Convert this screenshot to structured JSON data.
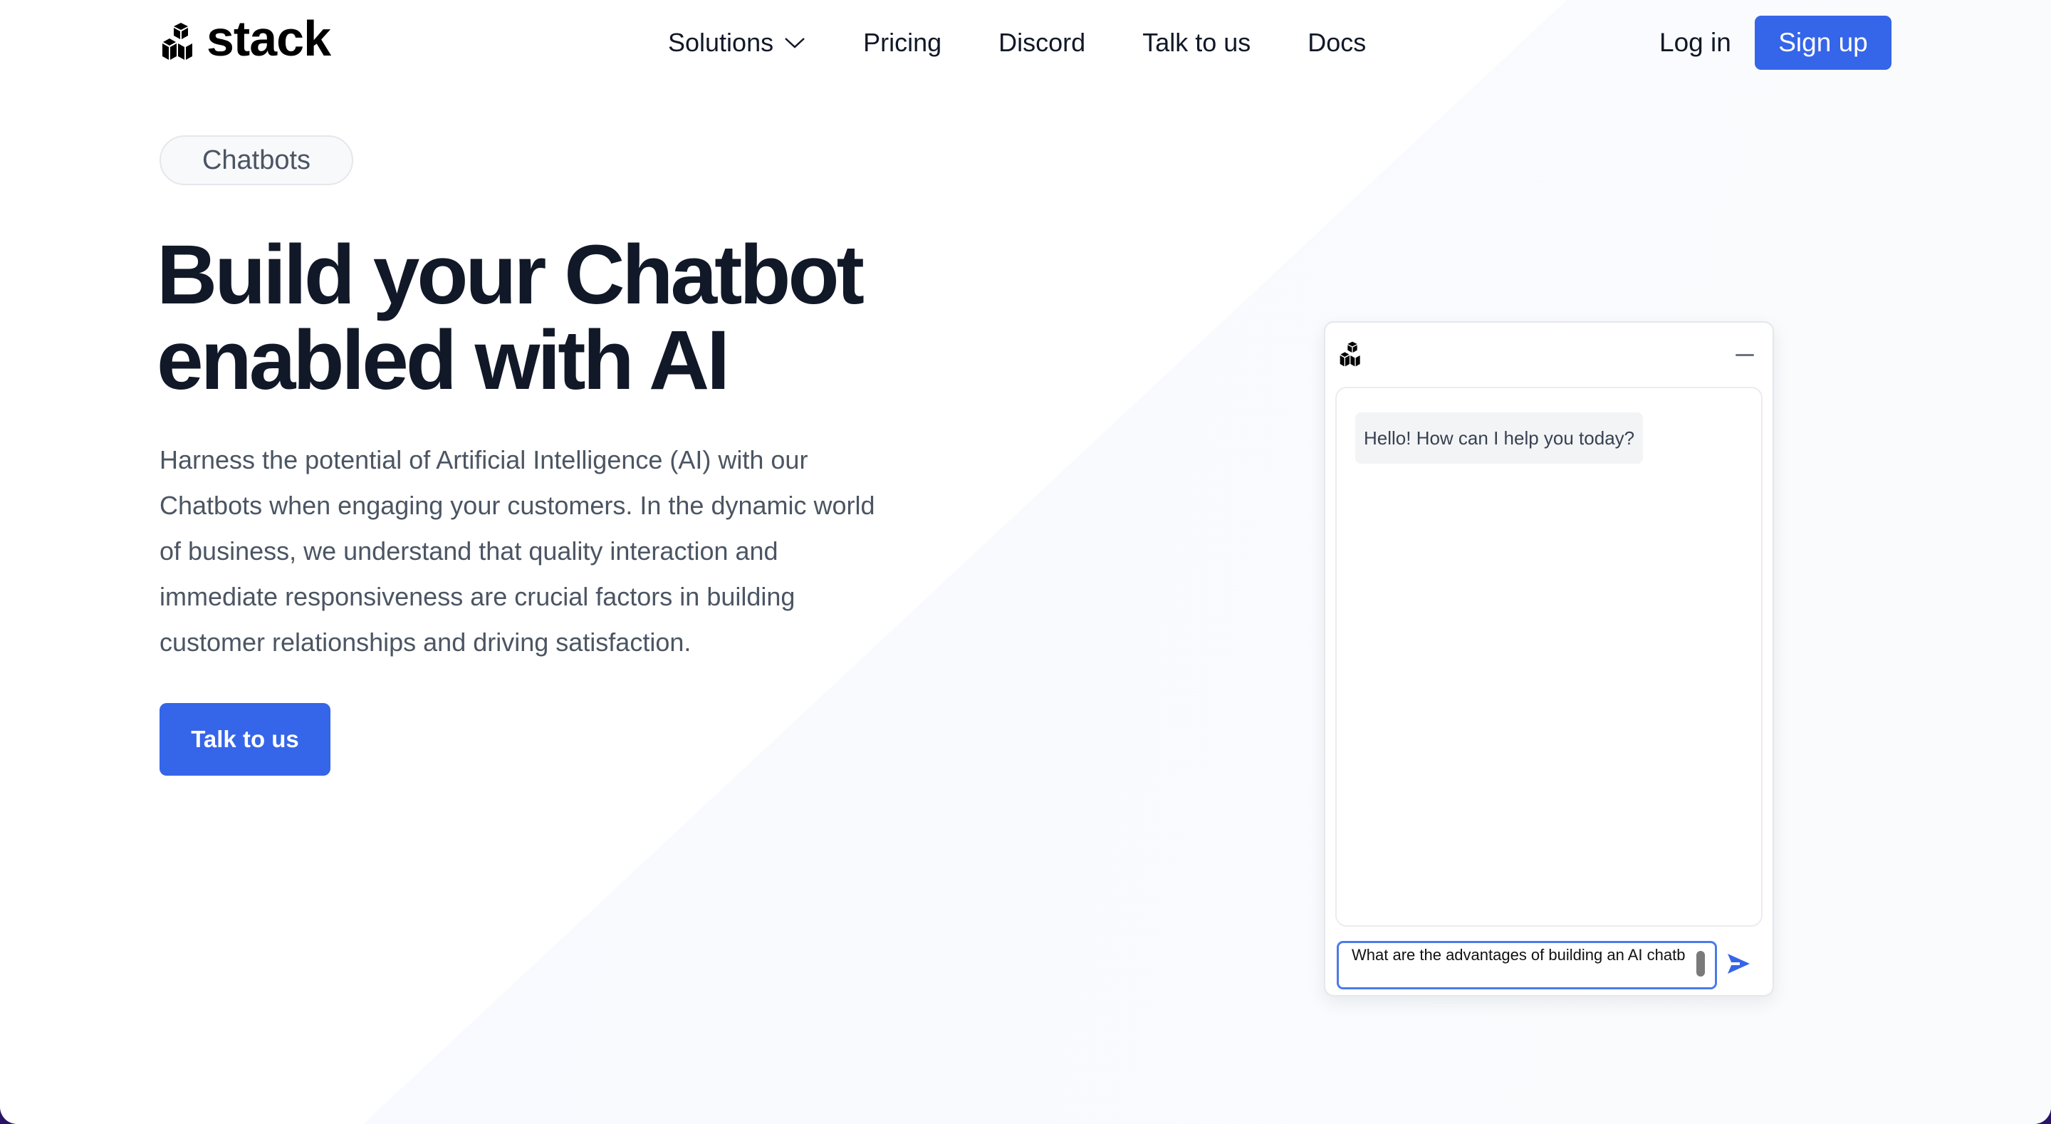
{
  "brand": {
    "name": "stack",
    "logo_icon": "stacked-cubes-icon"
  },
  "nav": {
    "items": [
      {
        "label": "Solutions",
        "has_dropdown": true
      },
      {
        "label": "Pricing"
      },
      {
        "label": "Discord"
      },
      {
        "label": "Talk to us"
      },
      {
        "label": "Docs"
      }
    ],
    "login_label": "Log in",
    "signup_label": "Sign up"
  },
  "hero": {
    "badge": "Chatbots",
    "title_line1": "Build your Chatbot",
    "title_line2": "enabled with AI",
    "description": "Harness the potential of Artificial Intelligence (AI) with our Chatbots when engaging your customers. In the dynamic world of business, we understand that quality interaction and immediate responsiveness are crucial factors in building customer relationships and driving satisfaction.",
    "cta_label": "Talk to us"
  },
  "chat": {
    "minimize_icon": "minimize-icon",
    "messages": [
      {
        "role": "bot",
        "text": "Hello! How can I help you today?"
      }
    ],
    "input_value": "What are the advantages of building an AI chatb",
    "send_icon": "send-icon"
  },
  "colors": {
    "accent": "#3565e8",
    "text_dark": "#111827",
    "text_muted": "#4b5563",
    "backdrop": "#2a1466",
    "tint": "#f8faff"
  }
}
